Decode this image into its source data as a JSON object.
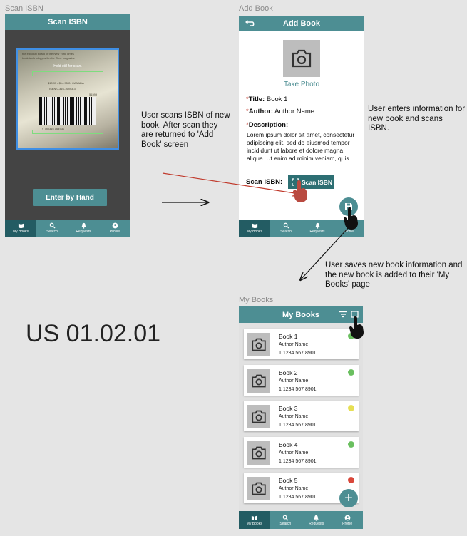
{
  "labels": {
    "scan_frame": "Scan ISBN",
    "add_frame": "Add Book",
    "books_frame": "My Books"
  },
  "scan_screen": {
    "title": "Scan ISBN",
    "hold_text": "Hold still for scan.",
    "enter_button": "Enter by Hand",
    "camera_text": {
      "line1": "the editorial board of the New York Times",
      "line2": "book technology writer for Time magazine",
      "price": "$10.95 / $14.95 IN CANADA",
      "isbn": "ISBN 0-316-16493-3",
      "code": "51599",
      "barcode_number": "9 780316 164931"
    }
  },
  "add_screen": {
    "title": "Add Book",
    "take_photo": "Take Photo",
    "title_label": "Title:",
    "title_value": "Book 1",
    "author_label": "Author:",
    "author_value": "Author Name",
    "description_label": "Description:",
    "description_text": "Lorem ipsum dolor sit amet, consectetur adipiscing elit, sed do eiusmod tempor incididunt ut labore et dolore magna aliqua. Ut enim ad minim veniam, quis",
    "scan_isbn_label": "Scan ISBN:",
    "scan_button": "Scan ISBN",
    "asterisk": "*"
  },
  "books_screen": {
    "title": "My Books",
    "books": [
      {
        "title": "Book 1",
        "author": "Author Name",
        "isbn": "1 1234 567 8901",
        "status_color": "#6abf5f"
      },
      {
        "title": "Book 2",
        "author": "Author Name",
        "isbn": "1 1234 567 8901",
        "status_color": "#6abf5f"
      },
      {
        "title": "Book 3",
        "author": "Author Name",
        "isbn": "1 1234 567 8901",
        "status_color": "#e6df54"
      },
      {
        "title": "Book 4",
        "author": "Author Name",
        "isbn": "1 1234 567 8901",
        "status_color": "#6abf5f"
      },
      {
        "title": "Book 5",
        "author": "Author Name",
        "isbn": "1 1234 567 8901",
        "status_color": "#d9473a"
      }
    ],
    "fab": "+"
  },
  "nav": {
    "my_books": "My Books",
    "search": "Search",
    "requests": "Requests",
    "profile": "Profile"
  },
  "annotations": {
    "scan_note": "User scans ISBN of new book. After scan they are returned to 'Add Book' screen",
    "add_note": "User enters information for new book and scans ISBN.",
    "save_note": "User saves new book information and the new book is added to their 'My Books' page",
    "story_id": "US 01.02.01"
  },
  "colors": {
    "primary": "#4d8e93",
    "primary_dark": "#235c63",
    "arrow_red": "#c0392b"
  }
}
